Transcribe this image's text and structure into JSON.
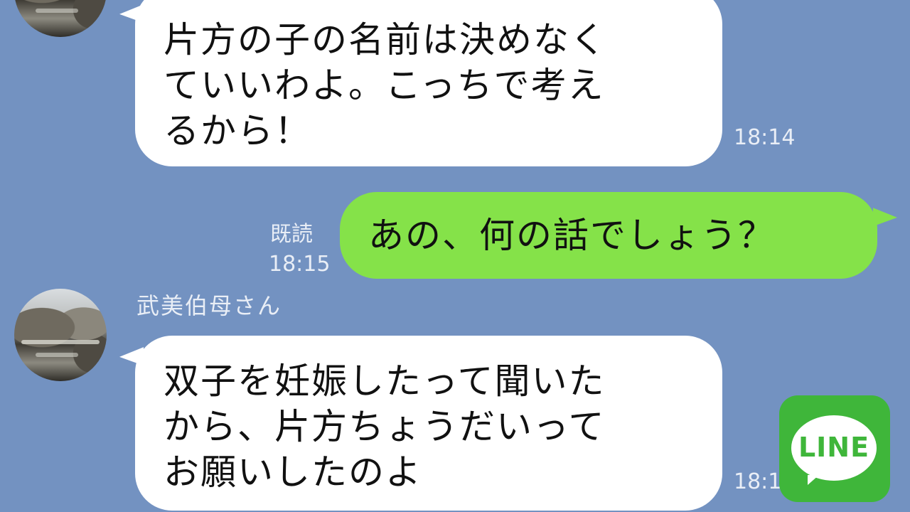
{
  "messages": [
    {
      "type": "incoming",
      "lines": [
        "片方の子の名前は決めなく",
        "ていいわよ。こっちで考え",
        "るから！"
      ],
      "time": "18:14"
    },
    {
      "type": "outgoing",
      "read_label": "既読",
      "time": "18:15",
      "lines": [
        "あの、何の話でしょう？"
      ]
    },
    {
      "type": "incoming",
      "sender": "武美伯母さん",
      "lines": [
        "双子を妊娠したって聞いた",
        "から、片方ちょうだいって",
        "お願いしたのよ"
      ],
      "time": "18:1"
    }
  ],
  "logo": {
    "text": "LINE",
    "icon": "line-app-logo"
  },
  "colors": {
    "background": "#7392c1",
    "incoming_bubble": "#ffffff",
    "outgoing_bubble": "#85e249",
    "logo_green": "#3fb63a"
  }
}
